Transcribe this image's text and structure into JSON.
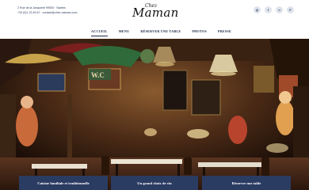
{
  "contact": {
    "address": "2 Rue de la Jonquière 99000 · Nantes",
    "phone_email": "+33 (0)1 23 45 67 · contact@chez-maman.com"
  },
  "logo": {
    "small": "Chez",
    "large": "Maman"
  },
  "socials": [
    {
      "icon": "instagram-icon",
      "glyph": "◎"
    },
    {
      "icon": "facebook-icon",
      "glyph": "f"
    },
    {
      "icon": "tripadvisor-icon",
      "glyph": "∞"
    },
    {
      "icon": "foursquare-icon",
      "glyph": "F"
    }
  ],
  "nav": {
    "items": [
      "ACCUEIL",
      "MENU",
      "RÉSERVER UNE TABLE",
      "PHOTOS",
      "PRESSE"
    ],
    "active": "ACCUEIL"
  },
  "cta": {
    "family": "Cuisine familiale et traditionnelle",
    "wine": "Un grand choix de vin",
    "reserve": "Réserver une table"
  },
  "hero": {
    "sign_text": "W.C",
    "accent_color": "#2b3c63"
  }
}
